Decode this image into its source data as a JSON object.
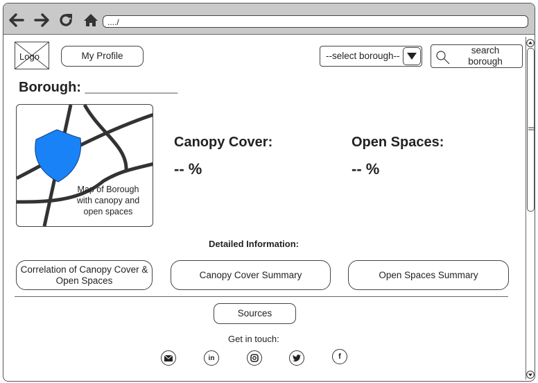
{
  "browser": {
    "url": "..../"
  },
  "header": {
    "logo_label": "Logo",
    "profile_button": "My Profile",
    "borough_select": "--select borough--",
    "search_label": "search borough"
  },
  "main": {
    "borough_title": "Borough: ____________",
    "map_label": "Map of Borough with canopy and open spaces",
    "canopy_title": "Canopy Cover:",
    "canopy_value": "-- %",
    "open_title": "Open Spaces:",
    "open_value": "-- %",
    "detail_label": "Detailed Information:",
    "buttons": [
      {
        "label": "Correlation of Canopy Cover & Open Spaces"
      },
      {
        "label": "Canopy Cover Summary"
      },
      {
        "label": "Open Spaces Summary"
      }
    ]
  },
  "footer": {
    "sources": "Sources",
    "contact": "Get in touch:",
    "social_icons": [
      "mail-icon",
      "linkedin-icon",
      "instagram-icon",
      "twitter-icon",
      "facebook-icon"
    ]
  },
  "colors": {
    "chrome": "#c9c9c9",
    "shield": "#1a82f7",
    "border": "#444444"
  }
}
